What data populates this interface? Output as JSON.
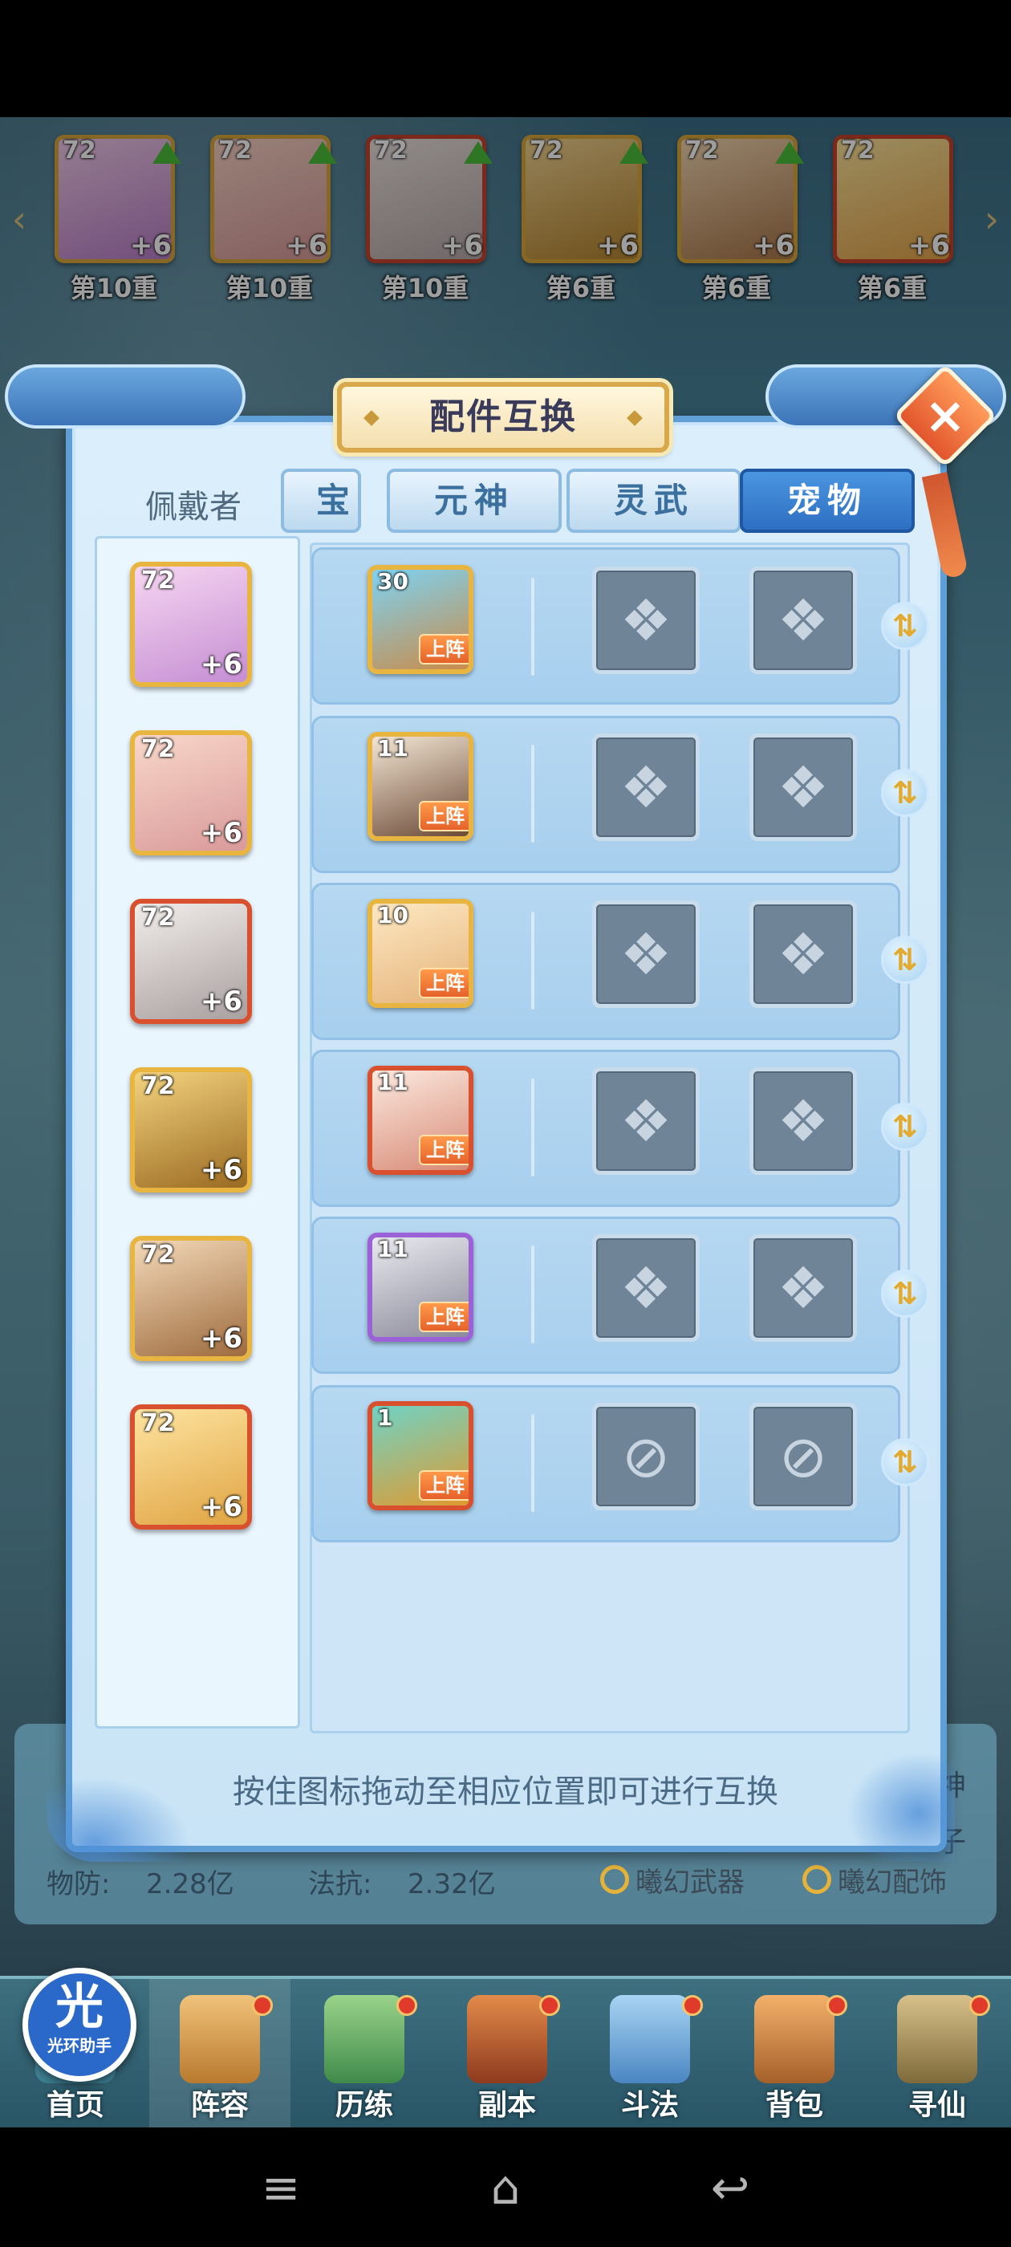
{
  "heroes_top": [
    {
      "level": "72",
      "plus": "+6",
      "rank": "第10重"
    },
    {
      "level": "72",
      "plus": "+6",
      "rank": "第10重"
    },
    {
      "level": "72",
      "plus": "+6",
      "rank": "第10重"
    },
    {
      "level": "72",
      "plus": "+6",
      "rank": "第6重"
    },
    {
      "level": "72",
      "plus": "+6",
      "rank": "第6重"
    },
    {
      "level": "72",
      "plus": "+6",
      "rank": "第6重"
    }
  ],
  "dialog": {
    "title": "配件互换",
    "close_icon": "×",
    "wearer_header": "佩戴者",
    "tabs": [
      {
        "label": "宝",
        "partial": true
      },
      {
        "label": "元神",
        "active": false
      },
      {
        "label": "灵武",
        "active": false
      },
      {
        "label": "宠物",
        "active": true
      }
    ],
    "rows": [
      {
        "hero_level": "72",
        "hero_plus": "+6",
        "pet_level": "30",
        "pet_badge": "上阵",
        "slot_icon": "fox-slot-icon",
        "swap_icon": "⇅"
      },
      {
        "hero_level": "72",
        "hero_plus": "+6",
        "pet_level": "11",
        "pet_badge": "上阵",
        "slot_icon": "fox-slot-icon",
        "swap_icon": "⇅"
      },
      {
        "hero_level": "72",
        "hero_plus": "+6",
        "pet_level": "10",
        "pet_badge": "上阵",
        "slot_icon": "fox-slot-icon",
        "swap_icon": "⇅"
      },
      {
        "hero_level": "72",
        "hero_plus": "+6",
        "pet_level": "11",
        "pet_badge": "上阵",
        "slot_icon": "fox-slot-icon",
        "swap_icon": "⇅"
      },
      {
        "hero_level": "72",
        "hero_plus": "+6",
        "pet_level": "11",
        "pet_badge": "上阵",
        "slot_icon": "fox-slot-icon",
        "swap_icon": "⇅"
      },
      {
        "hero_level": "72",
        "hero_plus": "+6",
        "pet_level": "1",
        "pet_badge": "上阵",
        "slot_icon": "locked-slot-icon",
        "swap_icon": "⇅"
      }
    ],
    "hint": "按住图标拖动至相应位置即可进行互换"
  },
  "stats": {
    "physical_def_label": "物防:",
    "physical_def_value": "2.28亿",
    "magic_res_label": "法抗:",
    "magic_res_value": "2.32亿",
    "equip_weapon": "曦幻武器",
    "equip_accessory": "曦幻配饰",
    "side_1": "神",
    "side_2": "子"
  },
  "bottom_nav": [
    {
      "label": "首页",
      "dot": false
    },
    {
      "label": "阵容",
      "dot": true
    },
    {
      "label": "历练",
      "dot": true
    },
    {
      "label": "副本",
      "dot": true
    },
    {
      "label": "斗法",
      "dot": true
    },
    {
      "label": "背包",
      "dot": true
    },
    {
      "label": "寻仙",
      "dot": true
    }
  ],
  "assistant": {
    "big": "光",
    "small": "光环助手"
  },
  "system_nav": {
    "menu": "≡",
    "home": "⌂",
    "back": "↩"
  }
}
